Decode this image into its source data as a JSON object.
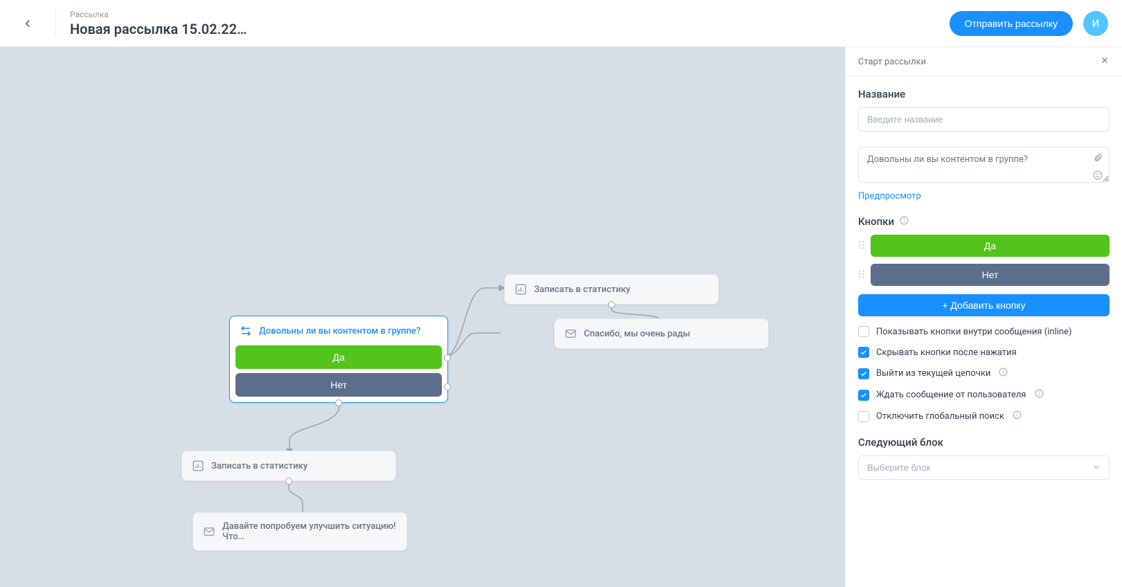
{
  "header": {
    "breadcrumb": "Рассылка",
    "title": "Новая рассылка 15.02.22…",
    "send_label": "Отправить рассылку",
    "avatar_initial": "И"
  },
  "canvas": {
    "node_start": {
      "title": "Довольны ли вы контентом в группе?",
      "btn_yes": "Да",
      "btn_no": "Нет"
    },
    "node_stat1": {
      "title": "Записать в статистику"
    },
    "node_thanks": {
      "title": "Спасибо, мы очень рады"
    },
    "node_stat2": {
      "title": "Записать в статистику"
    },
    "node_improve": {
      "title": "Давайте попробуем улучшить ситуацию! Что…"
    }
  },
  "panel": {
    "header": "Старт рассылки",
    "name_label": "Название",
    "name_placeholder": "Введите название",
    "message_value": "Довольны ли вы контентом в группе?",
    "preview_link": "Предпросмотр",
    "buttons_label": "Кнопки",
    "btn_rows": [
      {
        "label": "Да",
        "color": "#52c41a"
      },
      {
        "label": "Нет",
        "color": "#5a6f8c"
      }
    ],
    "add_button": "+ Добавить кнопку",
    "checks": [
      {
        "label": "Показывать кнопки внутри сообщения (inline)",
        "checked": false,
        "info": false
      },
      {
        "label": "Скрывать кнопки после нажатия",
        "checked": true,
        "info": false
      },
      {
        "label": "Выйти из текущей цепочки",
        "checked": true,
        "info": true
      },
      {
        "label": "Ждать сообщение от пользователя",
        "checked": true,
        "info": true
      },
      {
        "label": "Отключить глобальный поиск",
        "checked": false,
        "info": true
      }
    ],
    "next_block_label": "Следующий блок",
    "next_block_placeholder": "Выберите блок"
  }
}
